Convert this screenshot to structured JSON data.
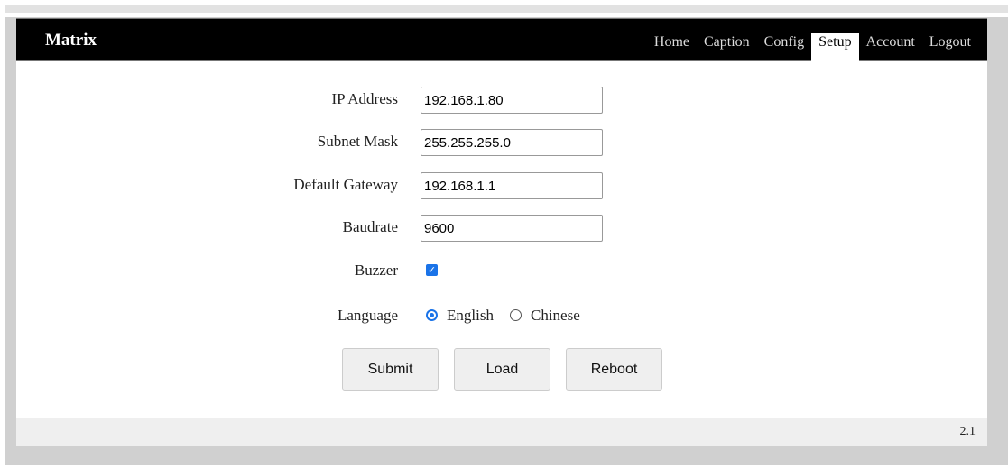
{
  "header": {
    "brand": "Matrix",
    "nav": [
      "Home",
      "Caption",
      "Config",
      "Setup",
      "Account",
      "Logout"
    ],
    "active": "Setup"
  },
  "form": {
    "ip_label": "IP Address",
    "ip_value": "192.168.1.80",
    "mask_label": "Subnet Mask",
    "mask_value": "255.255.255.0",
    "gateway_label": "Default Gateway",
    "gateway_value": "192.168.1.1",
    "baud_label": "Baudrate",
    "baud_value": "9600",
    "buzzer_label": "Buzzer",
    "buzzer_checked": true,
    "language_label": "Language",
    "language_options": [
      "English",
      "Chinese"
    ],
    "language_selected": "English"
  },
  "buttons": {
    "submit": "Submit",
    "load": "Load",
    "reboot": "Reboot"
  },
  "footer": {
    "version": "2.1"
  },
  "colors": {
    "accent": "#1a73e8",
    "header_bg": "#000000"
  }
}
